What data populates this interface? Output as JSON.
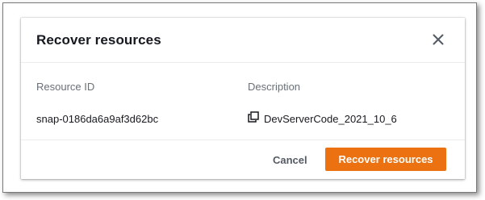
{
  "dialog": {
    "title": "Recover resources",
    "close_icon": "close-icon"
  },
  "details": {
    "resource_id_label": "Resource ID",
    "resource_id_value": "snap-0186da6a9af3d62bc",
    "description_label": "Description",
    "description_value": "DevServerCode_2021_10_6",
    "copy_icon": "copy-icon"
  },
  "footer": {
    "cancel_label": "Cancel",
    "primary_label": "Recover resources"
  },
  "colors": {
    "primary": "#ec7211",
    "text": "#16191f",
    "label": "#687078"
  }
}
